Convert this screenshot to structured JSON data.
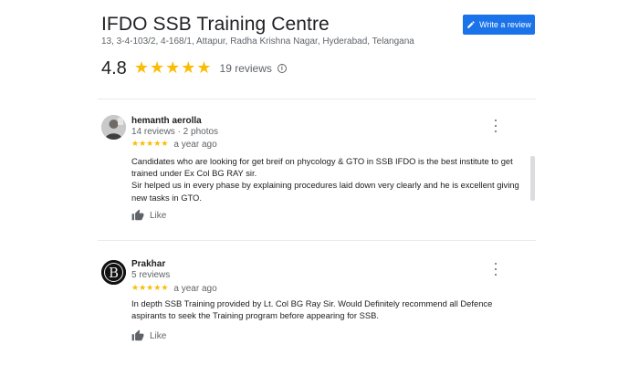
{
  "place": {
    "title": "IFDO SSB Training Centre",
    "address": "13, 3-4-103/2, 4-168/1, Attapur, Radha Krishna Nagar, Hyderabad, Telangana",
    "rating": "4.8",
    "stars": 5,
    "reviews_count": "19 reviews"
  },
  "actions": {
    "write_review_label": "Write a review",
    "write_review_icon": "pencil-icon"
  },
  "colors": {
    "accent": "#1a73e8",
    "star": "#fbbc04",
    "secondary_text": "#5f6368"
  },
  "reviews": [
    {
      "author": "hemanth aerolla",
      "meta": "14 reviews · 2 photos",
      "stars": 5,
      "time": "a year ago",
      "text": [
        "Candidates who are looking for get breif on phycology & GTO in SSB IFDO is the best institute to get",
        "trained under Ex Col BG RAY sir.",
        "Sir helped us in every phase by explaining procedures laid down very clearly and he is excellent giving",
        "new tasks in GTO."
      ],
      "like_label": "Like"
    },
    {
      "author": "Prakhar",
      "meta": "5 reviews",
      "stars": 5,
      "time": "a year ago",
      "text": [
        "In depth SSB Training provided by Lt. Col BG Ray Sir. Would Definitely recommend all Defence",
        "aspirants to seek the Training program before appearing for SSB."
      ],
      "like_label": "Like"
    }
  ]
}
